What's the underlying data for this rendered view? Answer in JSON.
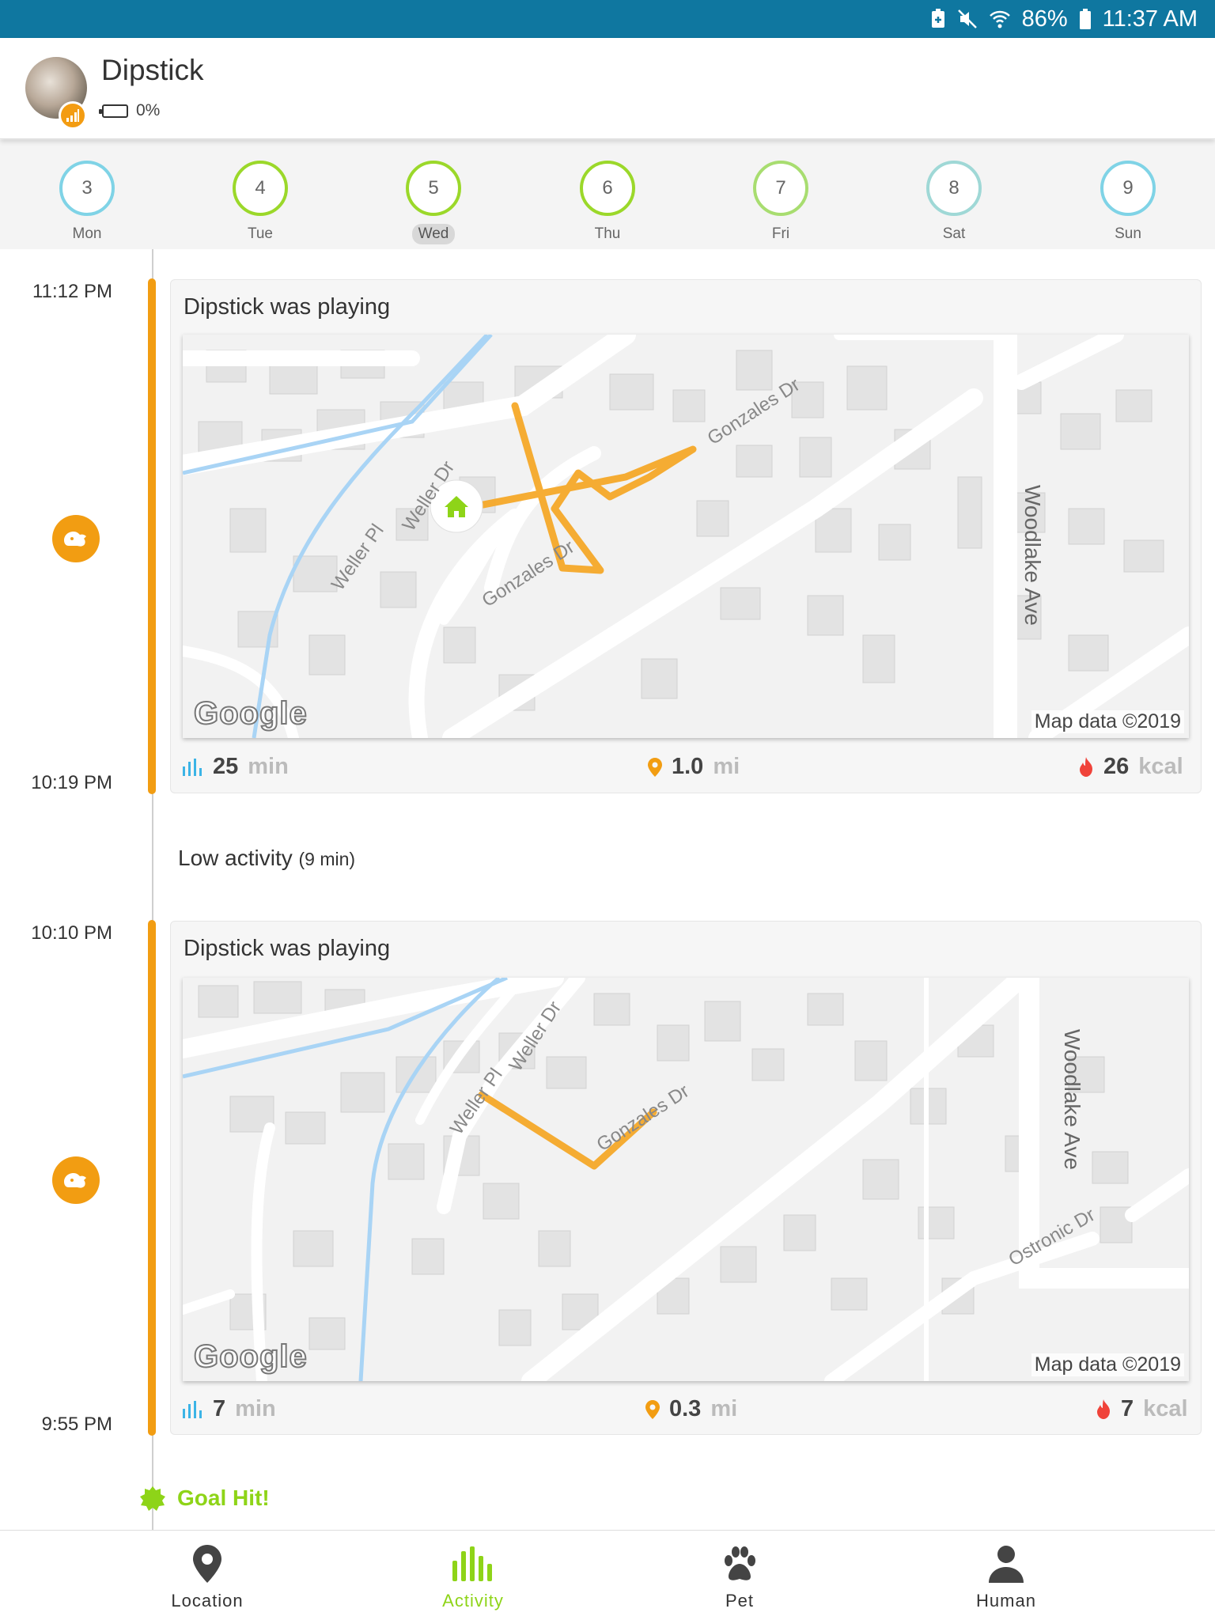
{
  "status_bar": {
    "battery_percent": "86%",
    "time": "11:37 AM"
  },
  "header": {
    "pet_name": "Dipstick",
    "battery_level": "0%"
  },
  "week": [
    {
      "date": "3",
      "day": "Mon",
      "selected": false,
      "ring": "#7fd3e6"
    },
    {
      "date": "4",
      "day": "Tue",
      "selected": false,
      "ring": "#9bd82a"
    },
    {
      "date": "5",
      "day": "Wed",
      "selected": true,
      "ring": "#9bd82a"
    },
    {
      "date": "6",
      "day": "Thu",
      "selected": false,
      "ring": "#9bd82a"
    },
    {
      "date": "7",
      "day": "Fri",
      "selected": false,
      "ring": "#9bd82a"
    },
    {
      "date": "8",
      "day": "Sat",
      "selected": false,
      "ring": "#7fd3e6"
    },
    {
      "date": "9",
      "day": "Sun",
      "selected": false,
      "ring": "#7fd3e6"
    }
  ],
  "activities": [
    {
      "start_time": "11:12 PM",
      "end_time": "10:19 PM",
      "title": "Dipstick was playing",
      "map": {
        "streets": [
          "Gonzales Dr",
          "Woodlake Ave",
          "Weller Dr",
          "Weller Pl",
          "Gonzales Dr"
        ],
        "credit": "Map data ©2019",
        "logo": "Google"
      },
      "duration": {
        "value": "25",
        "unit": "min"
      },
      "distance": {
        "value": "1.0",
        "unit": "mi"
      },
      "calories": {
        "value": "26",
        "unit": "kcal"
      }
    },
    {
      "start_time": "10:10 PM",
      "end_time": "9:55 PM",
      "title": "Dipstick was playing",
      "map": {
        "streets": [
          "Weller Dr",
          "Weller Pl",
          "Gonzales Dr",
          "Woodlake Ave",
          "Ostronic Dr"
        ],
        "credit": "Map data ©2019",
        "logo": "Google"
      },
      "duration": {
        "value": "7",
        "unit": "min"
      },
      "distance": {
        "value": "0.3",
        "unit": "mi"
      },
      "calories": {
        "value": "7",
        "unit": "kcal"
      }
    }
  ],
  "low_activity": {
    "label": "Low activity",
    "duration": "(9 min)"
  },
  "goal": {
    "label": "Goal Hit!"
  },
  "bottom_nav": [
    {
      "label": "Location",
      "icon": "location-pin-icon",
      "active": false
    },
    {
      "label": "Activity",
      "icon": "activity-bars-icon",
      "active": true
    },
    {
      "label": "Pet",
      "icon": "paw-icon",
      "active": false
    },
    {
      "label": "Human",
      "icon": "person-icon",
      "active": false
    }
  ],
  "colors": {
    "accent": "#f29d12",
    "active_green": "#8ed418",
    "status_bar": "#0f77a0",
    "route": "#f5a623"
  }
}
